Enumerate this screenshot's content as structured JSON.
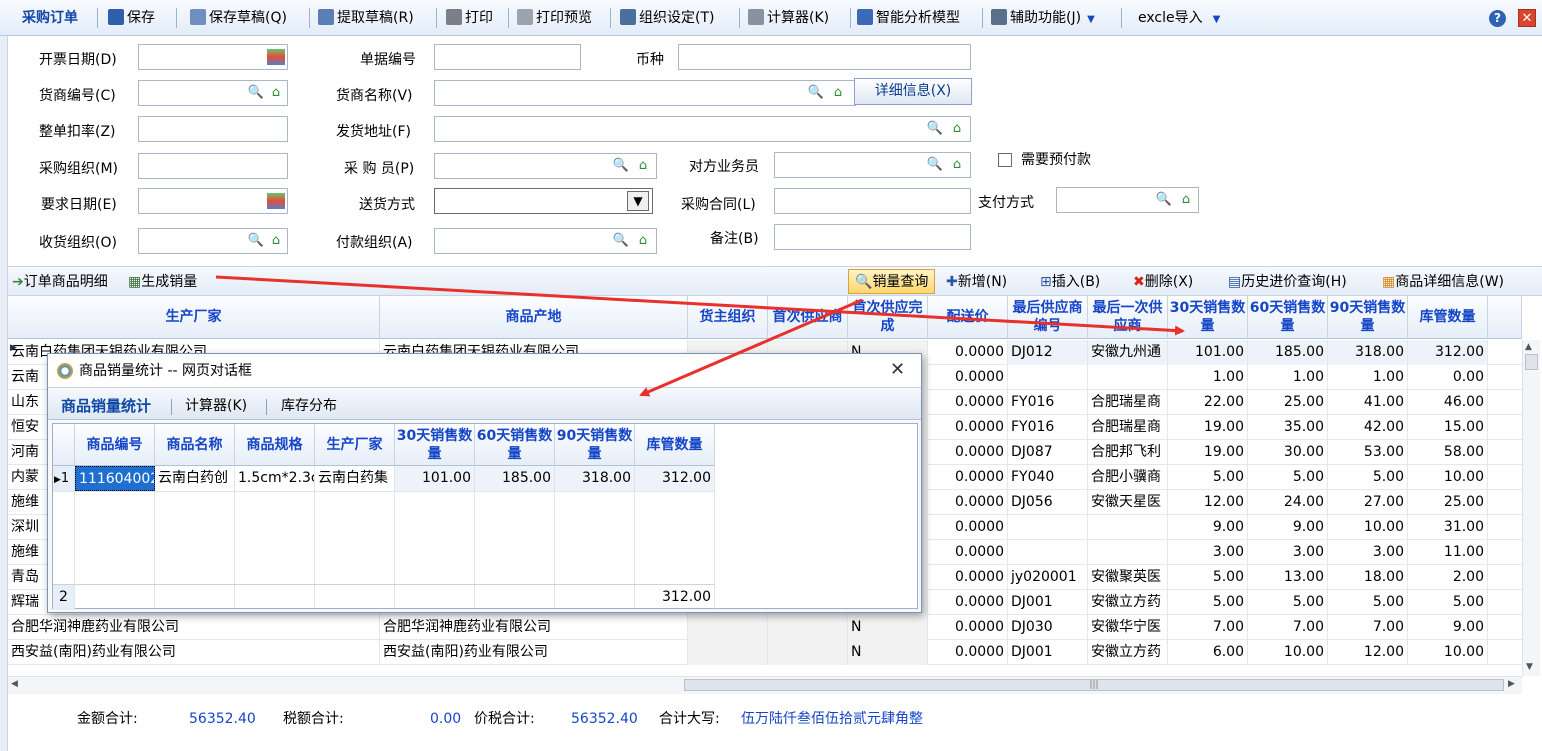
{
  "toolbar": {
    "title": "采购订单",
    "save": "保存",
    "save_draft": "保存草稿(Q)",
    "fetch_draft": "提取草稿(R)",
    "print": "打印",
    "print_preview": "打印预览",
    "org_settings": "组织设定(T)",
    "calculator": "计算器(K)",
    "smart_model": "智能分析模型",
    "aux": "辅助功能(J)",
    "excel": "excle导入"
  },
  "form": {
    "invoice_date": "开票日期(D)",
    "doc_no": "单据编号",
    "currency": "币种",
    "supplier_no": "货商编号(C)",
    "supplier_name": "货商名称(V)",
    "detail_button": "详细信息(X)",
    "discount_rate": "整单扣率(Z)",
    "ship_address": "发货地址(F)",
    "purchase_org": "采购组织(M)",
    "purchaser": "采 购 员(P)",
    "counterpart_staff": "对方业务员",
    "need_prepay": "需要预付款",
    "required_date": "要求日期(E)",
    "delivery_method": "送货方式",
    "purchase_contract": "采购合同(L)",
    "payment_method": "支付方式",
    "receive_org": "收货组织(O)",
    "payment_org": "付款组织(A)",
    "remark": "备注(B)"
  },
  "gridbar": {
    "order_detail": "订单商品明细",
    "gen_sales": "生成销量",
    "sales_query": "销量查询",
    "add": "新增(N)",
    "insert": "插入(B)",
    "delete": "删除(X)",
    "history_price": "历史进价查询(H)",
    "product_detail": "商品详细信息(W)"
  },
  "grid": {
    "headers": {
      "maker": "生产厂家",
      "origin": "商品产地",
      "owner_org": "货主组织",
      "first_supplier": "首次供应商",
      "first_done": "首次供应完成",
      "dist_price": "配送价",
      "last_supplier_no": "最后供应商编号",
      "last_supplier": "最后一次供应商",
      "sales30": "30天销售数量",
      "sales60": "60天销售数量",
      "sales90": "90天销售数量",
      "stock": "库管数量"
    },
    "rows": [
      {
        "maker": "云南白药集团天银药业有限公司",
        "origin": "云南白药集团天银药业有限公司",
        "flag": "N",
        "price": "0.0000",
        "sno": "DJ012",
        "sname": "安徽九州通",
        "s30": "101.00",
        "s60": "185.00",
        "s90": "318.00",
        "stock": "312.00"
      },
      {
        "maker": "云南",
        "origin": "",
        "flag": "",
        "price": "0.0000",
        "sno": "",
        "sname": "",
        "s30": "1.00",
        "s60": "1.00",
        "s90": "1.00",
        "stock": "0.00"
      },
      {
        "maker": "山东",
        "origin": "",
        "flag": "",
        "price": "0.0000",
        "sno": "FY016",
        "sname": "合肥瑞星商",
        "s30": "22.00",
        "s60": "25.00",
        "s90": "41.00",
        "stock": "46.00"
      },
      {
        "maker": "恒安",
        "origin": "",
        "flag": "",
        "price": "0.0000",
        "sno": "FY016",
        "sname": "合肥瑞星商",
        "s30": "19.00",
        "s60": "35.00",
        "s90": "42.00",
        "stock": "15.00"
      },
      {
        "maker": "河南",
        "origin": "",
        "flag": "",
        "price": "0.0000",
        "sno": "DJ087",
        "sname": "合肥邦飞利",
        "s30": "19.00",
        "s60": "30.00",
        "s90": "53.00",
        "stock": "58.00"
      },
      {
        "maker": "内蒙",
        "origin": "",
        "flag": "",
        "price": "0.0000",
        "sno": "FY040",
        "sname": "合肥小骥商",
        "s30": "5.00",
        "s60": "5.00",
        "s90": "5.00",
        "stock": "10.00"
      },
      {
        "maker": "施维",
        "origin": "",
        "flag": "",
        "price": "0.0000",
        "sno": "DJ056",
        "sname": "安徽天星医",
        "s30": "12.00",
        "s60": "24.00",
        "s90": "27.00",
        "stock": "25.00"
      },
      {
        "maker": "深圳",
        "origin": "",
        "flag": "",
        "price": "0.0000",
        "sno": "",
        "sname": "",
        "s30": "9.00",
        "s60": "9.00",
        "s90": "10.00",
        "stock": "31.00"
      },
      {
        "maker": "施维",
        "origin": "",
        "flag": "",
        "price": "0.0000",
        "sno": "",
        "sname": "",
        "s30": "3.00",
        "s60": "3.00",
        "s90": "3.00",
        "stock": "11.00"
      },
      {
        "maker": "青岛",
        "origin": "",
        "flag": "",
        "price": "0.0000",
        "sno": "jy020001",
        "sname": "安徽聚英医",
        "s30": "5.00",
        "s60": "13.00",
        "s90": "18.00",
        "stock": "2.00"
      },
      {
        "maker": "辉瑞",
        "origin": "",
        "flag": "",
        "price": "0.0000",
        "sno": "DJ001",
        "sname": "安徽立方药",
        "s30": "5.00",
        "s60": "5.00",
        "s90": "5.00",
        "stock": "5.00"
      },
      {
        "maker": "合肥华润神鹿药业有限公司",
        "origin": "合肥华润神鹿药业有限公司",
        "flag": "N",
        "price": "0.0000",
        "sno": "DJ030",
        "sname": "安徽华宁医",
        "s30": "7.00",
        "s60": "7.00",
        "s90": "7.00",
        "stock": "9.00"
      },
      {
        "maker": "西安益(南阳)药业有限公司",
        "origin": "西安益(南阳)药业有限公司",
        "flag": "N",
        "price": "0.0000",
        "sno": "DJ001",
        "sname": "安徽立方药",
        "s30": "6.00",
        "s60": "10.00",
        "s90": "12.00",
        "stock": "10.00"
      }
    ]
  },
  "footer": {
    "amount_label": "金额合计:",
    "amount": "56352.40",
    "tax_label": "税额合计:",
    "tax": "0.00",
    "total_label": "价税合计:",
    "total": "56352.40",
    "upper_label": "合计大写:",
    "upper": "伍万陆仟叁佰伍拾贰元肆角整"
  },
  "dialog": {
    "title": "商品销量统计 -- 网页对话框",
    "tab_stats": "商品销量统计",
    "tab_calc": "计算器(K)",
    "tab_stock": "库存分布",
    "headers": {
      "code": "商品编号",
      "name": "商品名称",
      "spec": "商品规格",
      "maker": "生产厂家",
      "s30": "30天销售数量",
      "s60": "60天销售数量",
      "s90": "90天销售数量",
      "stock": "库管数量"
    },
    "row": {
      "idx": "1",
      "code": "111604002",
      "name": "云南白药创",
      "spec": "1.5cm*2.3c",
      "maker": "云南白药集",
      "s30": "101.00",
      "s60": "185.00",
      "s90": "318.00",
      "stock": "312.00"
    },
    "total_row": {
      "idx": "2",
      "stock": "312.00"
    }
  },
  "colors": {
    "accent": "#1646c8",
    "arrow": "#e8302c",
    "title": "#1148a8"
  }
}
